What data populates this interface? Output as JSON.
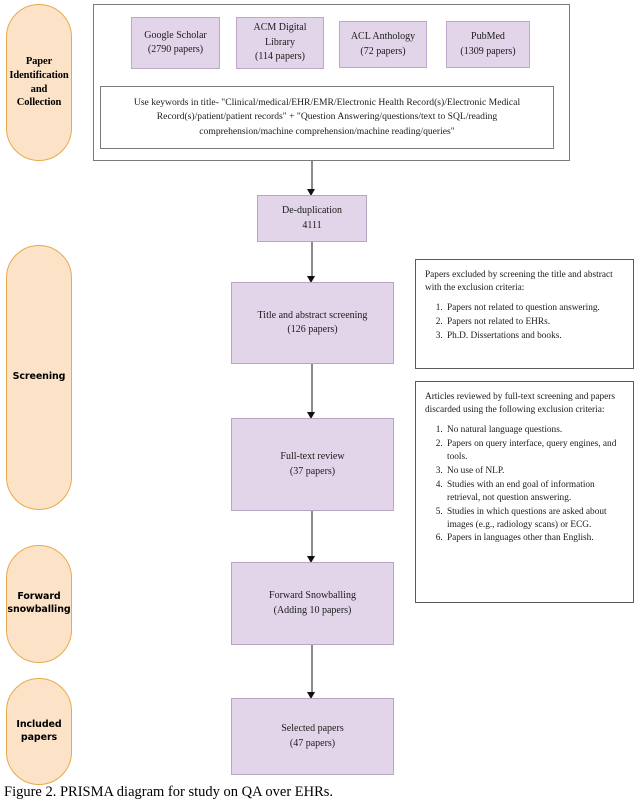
{
  "figure": {
    "caption": "Figure 2. PRISMA diagram for study on QA over EHRs."
  },
  "stages": [
    {
      "id": "identification",
      "label": "Paper\nIdentification\nand\nCollection",
      "line1": "Paper",
      "line2": "Identification",
      "line3": "and",
      "line4": "Collection"
    },
    {
      "id": "screening",
      "label": "Screening"
    },
    {
      "id": "forward-snowballing",
      "line1": "Forward",
      "line2": "snowballing"
    },
    {
      "id": "included",
      "line1": "Included",
      "line2": "papers"
    }
  ],
  "sources": [
    {
      "name": "Google Scholar",
      "count": "(2790 papers)"
    },
    {
      "name": "ACM Digital",
      "name2": "Library",
      "count": "(114 papers)"
    },
    {
      "name": "ACL Anthology",
      "count": "(72 papers)"
    },
    {
      "name": "PubMed",
      "count": "(1309 papers)"
    }
  ],
  "keywords": {
    "line1": "Use keywords in title-  \"Clinical/medical/EHR/EMR/Electronic Health Record(s)/Electronic Medical",
    "line2": "Record(s)/patient/patient records\" + \"Question Answering/questions/text to SQL/reading",
    "line3": "comprehension/machine comprehension/machine reading/queries\""
  },
  "flow": {
    "dedup": {
      "title": "De-duplication",
      "count": "4111"
    },
    "title_abstract": {
      "title": "Title and abstract screening",
      "count": "(126 papers)"
    },
    "full_text": {
      "title": "Full-text review",
      "count": "(37 papers)"
    },
    "snowballing": {
      "title": "Forward Snowballing",
      "count": "(Adding 10 papers)"
    },
    "selected": {
      "title": "Selected papers",
      "count": "(47 papers)"
    }
  },
  "notes": {
    "screening": {
      "intro": "Papers excluded by screening the title and abstract with the exclusion criteria:",
      "items": [
        "Papers not related to question answering.",
        "Papers not related to EHRs.",
        "Ph.D. Dissertations and books."
      ]
    },
    "fulltext": {
      "intro": "Articles reviewed by full-text screening and papers discarded using the following exclusion criteria:",
      "items": [
        "No natural language questions.",
        "Papers on query interface, query engines, and tools.",
        "No use of NLP.",
        "Studies with an end goal of information retrieval, not question answering.",
        "Studies in which questions are asked about images (e.g., radiology scans) or ECG.",
        "Papers in languages other than English."
      ]
    }
  },
  "colors": {
    "process_fill": "#e3d5e9",
    "process_border": "#b9a4c4",
    "stage_fill": "#fce3c8",
    "stage_border": "#e8a94f",
    "container_border": "#7a7a7a",
    "connector": "#8c8c8c"
  }
}
